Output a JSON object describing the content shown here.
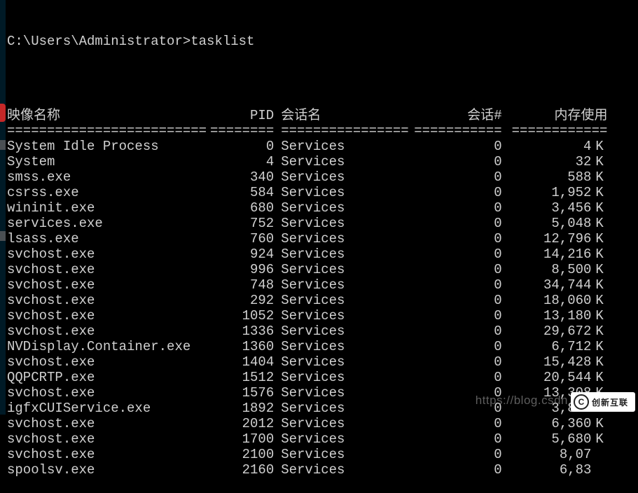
{
  "prompt": "C:\\Users\\Administrator>tasklist",
  "headers": {
    "name": "映像名称",
    "pid": "PID",
    "session": "会话名",
    "session_num": "会话#",
    "memory": "内存使用"
  },
  "separators": {
    "name": "=========================",
    "pid": "========",
    "session": "================",
    "session_num": "===========",
    "memory": "============"
  },
  "rows": [
    {
      "name": "System Idle Process",
      "pid": "0",
      "session": "Services",
      "snum": "0",
      "mem": "4",
      "unit": "K"
    },
    {
      "name": "System",
      "pid": "4",
      "session": "Services",
      "snum": "0",
      "mem": "32",
      "unit": "K"
    },
    {
      "name": "smss.exe",
      "pid": "340",
      "session": "Services",
      "snum": "0",
      "mem": "588",
      "unit": "K"
    },
    {
      "name": "csrss.exe",
      "pid": "584",
      "session": "Services",
      "snum": "0",
      "mem": "1,952",
      "unit": "K"
    },
    {
      "name": "wininit.exe",
      "pid": "680",
      "session": "Services",
      "snum": "0",
      "mem": "3,456",
      "unit": "K"
    },
    {
      "name": "services.exe",
      "pid": "752",
      "session": "Services",
      "snum": "0",
      "mem": "5,048",
      "unit": "K"
    },
    {
      "name": "lsass.exe",
      "pid": "760",
      "session": "Services",
      "snum": "0",
      "mem": "12,796",
      "unit": "K"
    },
    {
      "name": "svchost.exe",
      "pid": "924",
      "session": "Services",
      "snum": "0",
      "mem": "14,216",
      "unit": "K"
    },
    {
      "name": "svchost.exe",
      "pid": "996",
      "session": "Services",
      "snum": "0",
      "mem": "8,500",
      "unit": "K"
    },
    {
      "name": "svchost.exe",
      "pid": "748",
      "session": "Services",
      "snum": "0",
      "mem": "34,744",
      "unit": "K"
    },
    {
      "name": "svchost.exe",
      "pid": "292",
      "session": "Services",
      "snum": "0",
      "mem": "18,060",
      "unit": "K"
    },
    {
      "name": "svchost.exe",
      "pid": "1052",
      "session": "Services",
      "snum": "0",
      "mem": "13,180",
      "unit": "K"
    },
    {
      "name": "svchost.exe",
      "pid": "1336",
      "session": "Services",
      "snum": "0",
      "mem": "29,672",
      "unit": "K"
    },
    {
      "name": "NVDisplay.Container.exe",
      "pid": "1360",
      "session": "Services",
      "snum": "0",
      "mem": "6,712",
      "unit": "K"
    },
    {
      "name": "svchost.exe",
      "pid": "1404",
      "session": "Services",
      "snum": "0",
      "mem": "15,428",
      "unit": "K"
    },
    {
      "name": "QQPCRTP.exe",
      "pid": "1512",
      "session": "Services",
      "snum": "0",
      "mem": "20,544",
      "unit": "K"
    },
    {
      "name": "svchost.exe",
      "pid": "1576",
      "session": "Services",
      "snum": "0",
      "mem": "13,308",
      "unit": "K"
    },
    {
      "name": "igfxCUIService.exe",
      "pid": "1892",
      "session": "Services",
      "snum": "0",
      "mem": "3,840",
      "unit": "K"
    },
    {
      "name": "svchost.exe",
      "pid": "2012",
      "session": "Services",
      "snum": "0",
      "mem": "6,360",
      "unit": "K"
    },
    {
      "name": "svchost.exe",
      "pid": "1700",
      "session": "Services",
      "snum": "0",
      "mem": "5,680",
      "unit": "K"
    },
    {
      "name": "svchost.exe",
      "pid": "2100",
      "session": "Services",
      "snum": "0",
      "mem": "8,07",
      "unit": ""
    },
    {
      "name": "spoolsv.exe",
      "pid": "2160",
      "session": "Services",
      "snum": "0",
      "mem": "6,83",
      "unit": ""
    }
  ],
  "watermark": {
    "url_text": "https://blog.csdn",
    "logo_text": "创新互联",
    "logo_glyph": "C"
  }
}
